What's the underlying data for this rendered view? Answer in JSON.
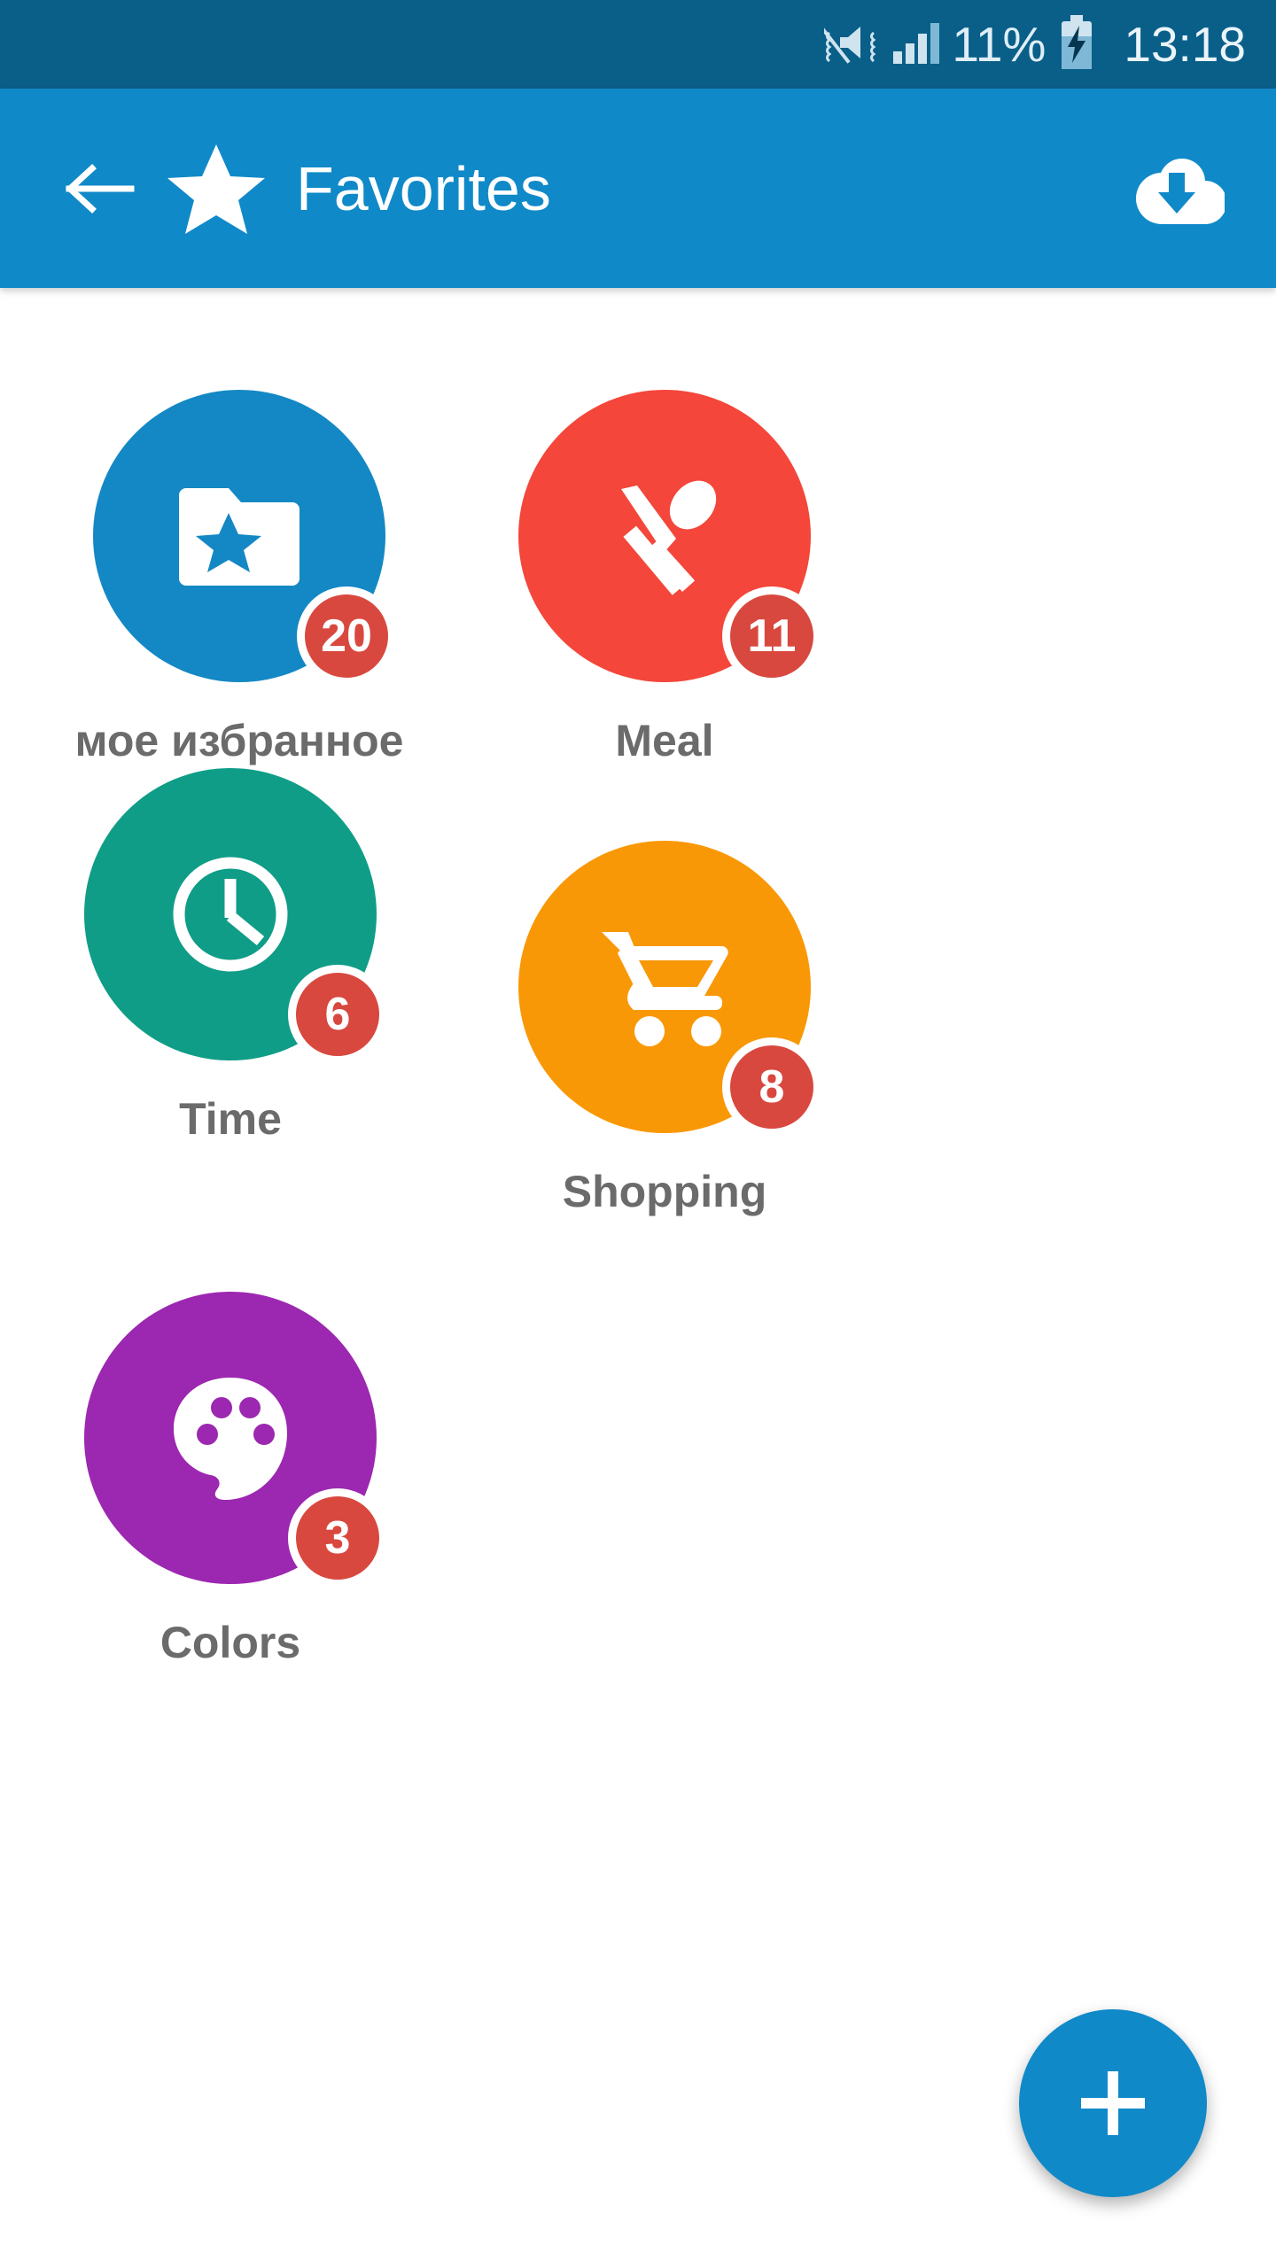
{
  "statusbar": {
    "battery_percent": "11%",
    "time": "13:18",
    "icons": [
      "vibrate-mute-icon",
      "signal-bars-icon",
      "battery-charging-icon"
    ]
  },
  "appbar": {
    "back_icon": "back-arrow-icon",
    "brand_icon": "star-icon",
    "title": "Favorites",
    "action_icon": "cloud-download-icon",
    "background": "#1089c8"
  },
  "categories": [
    {
      "label": "мое избранное",
      "badge": "20",
      "color": "#1488c4",
      "icon": "folder-star-icon"
    },
    {
      "label": "Meal",
      "badge": "11",
      "color": "#f4463a",
      "icon": "knife-spoon-icon"
    },
    {
      "label": "Time",
      "badge": "6",
      "color": "#0f9d87",
      "icon": "clock-icon"
    },
    {
      "label": "Shopping",
      "badge": "8",
      "color": "#f99806",
      "icon": "shopping-cart-icon"
    },
    {
      "label": "Colors",
      "badge": "3",
      "color": "#9c27b0",
      "icon": "palette-icon"
    }
  ],
  "fab": {
    "icon": "plus-icon",
    "color": "#1089c8"
  },
  "colors": {
    "statusbar": "#0a5f89",
    "accent": "#1089c8",
    "badge": "#d8483f",
    "label_text": "#6b6b6b",
    "page_background": "#ffffff"
  }
}
